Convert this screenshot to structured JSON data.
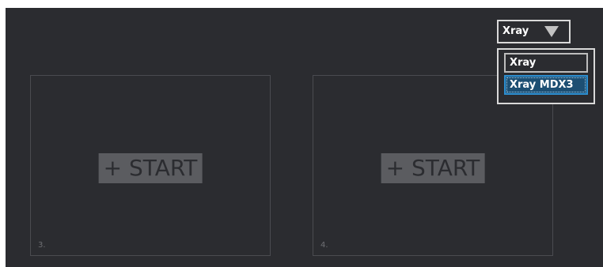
{
  "dropdown": {
    "selected": "Xray",
    "icon": "triangle-down-icon",
    "options": [
      "Xray",
      "Xray MDX3"
    ],
    "highlighted_index": 1
  },
  "panels": [
    {
      "number": "3.",
      "start_label": "+ START"
    },
    {
      "number": "4.",
      "start_label": "+ START"
    }
  ],
  "colors": {
    "background": "#2b2c30",
    "panel_border": "#4a4b50",
    "start_button": "#5b5c60",
    "highlight": "#1d4f73",
    "highlight_border": "#2e8fd0"
  }
}
